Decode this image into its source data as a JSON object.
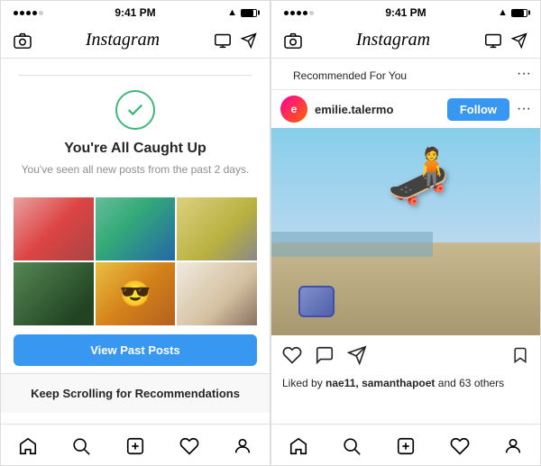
{
  "leftPhone": {
    "statusBar": {
      "time": "9:41 PM"
    },
    "navBar": {
      "logo": "Instagram"
    },
    "caughtUp": {
      "title": "You're All Caught Up",
      "subtitle": "You've seen all new posts from the past 2 days."
    },
    "viewPastPosts": "View Past Posts",
    "keepScrolling": "Keep Scrolling for Recommendations"
  },
  "rightPhone": {
    "statusBar": {
      "time": "9:41 PM"
    },
    "navBar": {
      "logo": "Instagram"
    },
    "recommended": "Recommended For You",
    "post": {
      "username": "emilie.talermo",
      "followLabel": "Follow",
      "likedBy": "Liked by",
      "likedUsers": "nae11, samanthapoet",
      "likedOthers": "and 63 others"
    }
  }
}
